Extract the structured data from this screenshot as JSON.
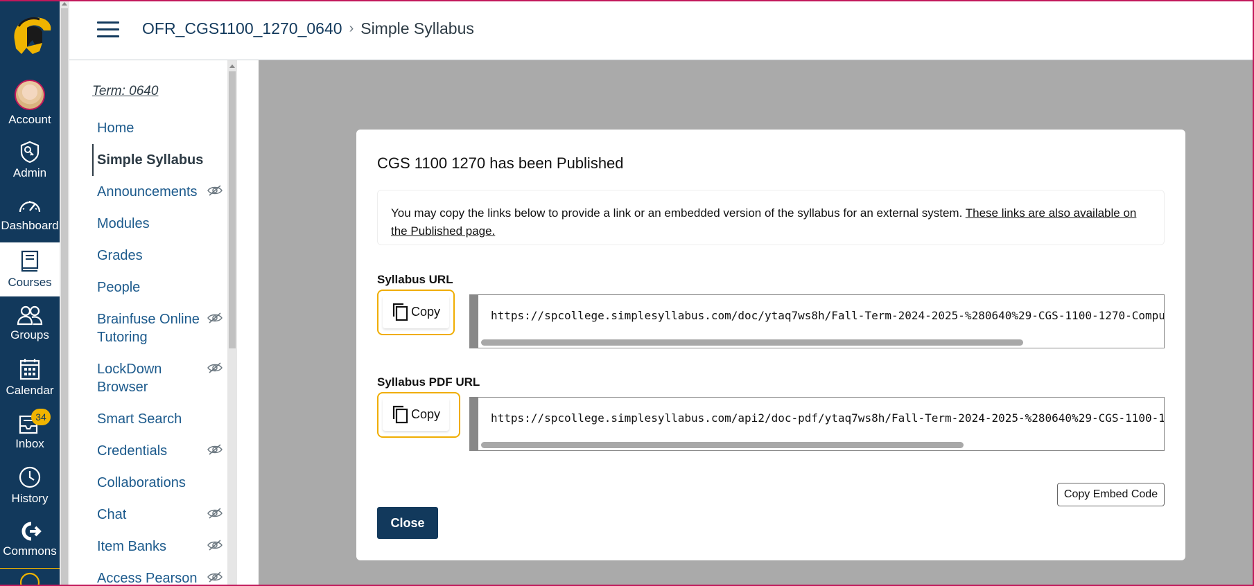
{
  "colors": {
    "nav_bg": "#12395c",
    "accent_gold": "#f0ad00",
    "link": "#1c5a8c",
    "overlay": "#aaaaaa",
    "frame": "#c2185b"
  },
  "global_nav": {
    "items": [
      {
        "label": "Account",
        "icon": "avatar"
      },
      {
        "label": "Admin",
        "icon": "shield-key-icon"
      },
      {
        "label": "Dashboard",
        "icon": "gauge-icon"
      },
      {
        "label": "Courses",
        "icon": "book-icon"
      },
      {
        "label": "Groups",
        "icon": "people-icon"
      },
      {
        "label": "Calendar",
        "icon": "calendar-icon"
      },
      {
        "label": "Inbox",
        "icon": "inbox-icon",
        "badge": "34"
      },
      {
        "label": "History",
        "icon": "clock-icon"
      },
      {
        "label": "Commons",
        "icon": "commons-icon"
      }
    ]
  },
  "header": {
    "course_link": "OFR_CGS1100_1270_0640",
    "separator": "›",
    "current_page": "Simple Syllabus"
  },
  "course_nav": {
    "term": "Term: 0640",
    "items": [
      {
        "label": "Home"
      },
      {
        "label": "Simple Syllabus"
      },
      {
        "label": "Announcements"
      },
      {
        "label": "Modules"
      },
      {
        "label": "Grades"
      },
      {
        "label": "People"
      },
      {
        "label": "Brainfuse Online Tutoring"
      },
      {
        "label": "LockDown Browser"
      },
      {
        "label": "Smart Search"
      },
      {
        "label": "Credentials"
      },
      {
        "label": "Collaborations"
      },
      {
        "label": "Chat"
      },
      {
        "label": "Item Banks"
      },
      {
        "label": "Access Pearson"
      }
    ]
  },
  "modal": {
    "title": "CGS 1100 1270 has been Published",
    "notice_text": "You may copy the links below to provide a link or an embedded version of the syllabus for an external system. ",
    "notice_link": "These links are also available on the Published page.",
    "syllabus_url_label": "Syllabus URL",
    "syllabus_url": "https://spcollege.simplesyllabus.com/doc/ytaq7ws8h/Fall-Term-2024-2025-%280640%29-CGS-1100-1270-Comput",
    "pdf_url_label": "Syllabus PDF URL",
    "pdf_url": "https://spcollege.simplesyllabus.com/api2/doc-pdf/ytaq7ws8h/Fall-Term-2024-2025-%280640%29-CGS-1100-12",
    "copy_label": "Copy",
    "embed_label": "Copy Embed Code",
    "close_label": "Close"
  }
}
